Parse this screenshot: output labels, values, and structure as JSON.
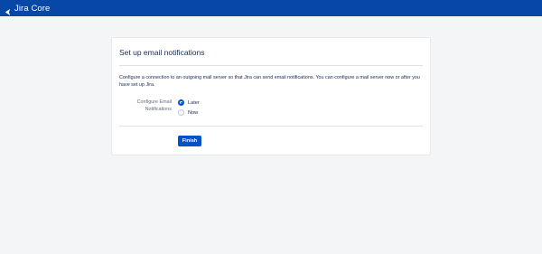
{
  "header": {
    "brand": "Jira Core",
    "icon": "jira-logo-icon",
    "color": "#0747a6"
  },
  "dialog": {
    "title": "Set up email notifications",
    "description": "Configure a connection to an outgoing mail server so that Jira can send email notifications. You can configure a mail server now or after you have set up Jira.",
    "field_label": "Configure Email Notifications",
    "options": [
      {
        "label": "Later",
        "checked": true
      },
      {
        "label": "Now",
        "checked": false
      }
    ],
    "finish_label": "Finish",
    "accent": "#0052cc"
  }
}
